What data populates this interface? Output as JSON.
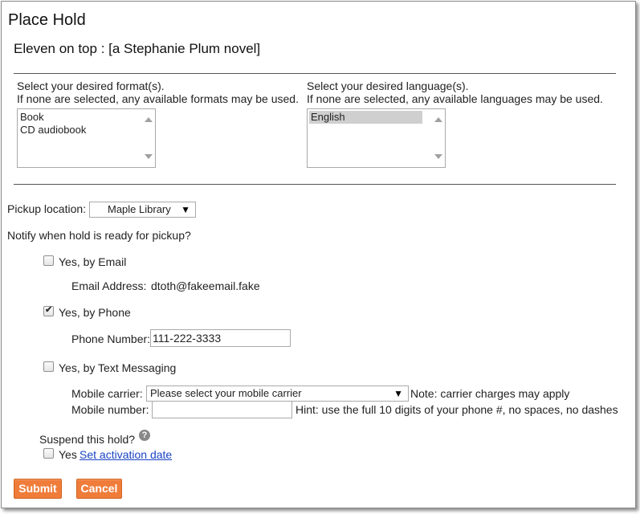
{
  "dialog": {
    "title": "Place Hold",
    "item_title": "Eleven on top : [a Stephanie Plum novel]"
  },
  "format": {
    "heading": "Select your desired format(s).",
    "note": "If none are selected, any available formats may be used.",
    "options": [
      "Book",
      "CD audiobook"
    ]
  },
  "language": {
    "heading": "Select your desired language(s).",
    "note": "If none are selected, any available languages may be used.",
    "options": [
      "English"
    ],
    "selected": "English"
  },
  "pickup": {
    "label": "Pickup location:",
    "value": "Maple Library"
  },
  "notify": {
    "heading": "Notify when hold is ready for pickup?",
    "email": {
      "label": "Yes, by Email",
      "checked": false,
      "address_label": "Email Address:",
      "address_value": "dtoth@fakeemail.fake"
    },
    "phone": {
      "label": "Yes, by Phone",
      "checked": true,
      "number_label": "Phone Number:",
      "number_value": "111-222-3333"
    },
    "sms": {
      "label": "Yes, by Text Messaging",
      "checked": false,
      "carrier_label": "Mobile carrier:",
      "carrier_value": "Please select your mobile carrier",
      "carrier_note": "Note: carrier charges may apply",
      "number_label": "Mobile number:",
      "number_value": "",
      "number_hint": "Hint: use the full 10 digits of your phone #, no spaces, no dashes"
    }
  },
  "suspend": {
    "label": "Suspend this hold?",
    "help_icon": "question-mark-icon",
    "help_glyph": "?",
    "yes_label": "Yes",
    "checked": false,
    "activation_link": "Set activation date"
  },
  "actions": {
    "submit_label": "Submit",
    "cancel_label": "Cancel"
  },
  "colors": {
    "button": "#f07c3a",
    "link": "#1a44c4",
    "selected_option": "#cfcfcf"
  }
}
